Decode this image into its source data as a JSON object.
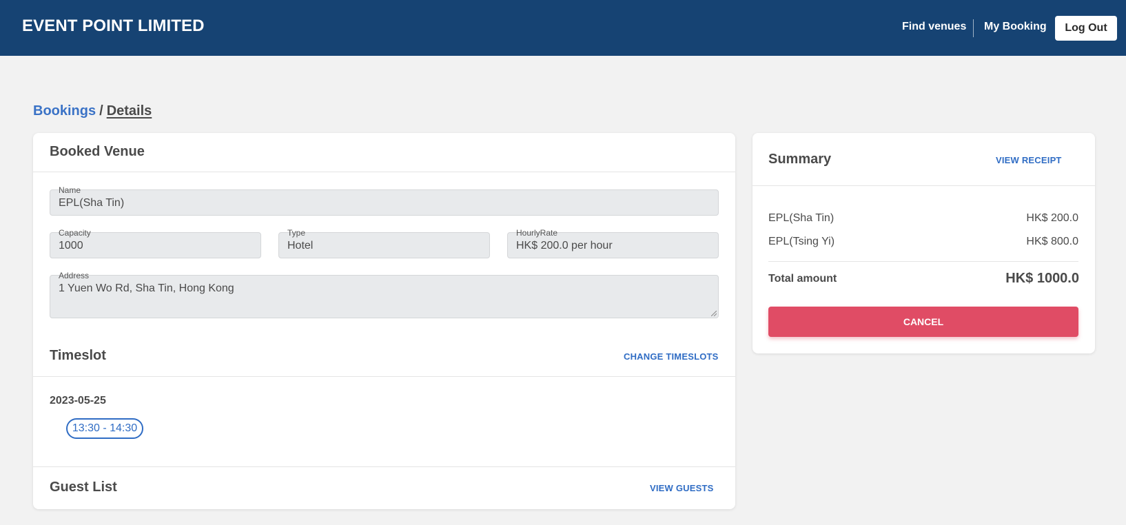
{
  "header": {
    "brand": "EVENT POINT LIMITED",
    "nav": {
      "find_venues": "Find venues",
      "my_booking": "My Booking",
      "logout": "Log Out"
    }
  },
  "breadcrumb": {
    "parent": "Bookings",
    "separator": "/",
    "current": "Details"
  },
  "booked_venue": {
    "title": "Booked Venue",
    "name": {
      "label": "Name",
      "value": "EPL(Sha Tin)"
    },
    "capacity": {
      "label": "Capacity",
      "value": "1000"
    },
    "type": {
      "label": "Type",
      "value": "Hotel"
    },
    "hourly_rate": {
      "label": "HourlyRate",
      "value": "HK$ 200.0 per hour"
    },
    "address": {
      "label": "Address",
      "value": "1 Yuen Wo Rd, Sha Tin, Hong Kong"
    }
  },
  "timeslot": {
    "title": "Timeslot",
    "change_label": "CHANGE TIMESLOTS",
    "date": "2023-05-25",
    "slots": [
      "13:30 - 14:30"
    ]
  },
  "guest_list": {
    "title": "Guest List",
    "view_label": "VIEW GUESTS"
  },
  "summary": {
    "title": "Summary",
    "receipt_label": "VIEW RECEIPT",
    "items": [
      {
        "name": "EPL(Sha Tin)",
        "amount": "HK$ 200.0"
      },
      {
        "name": "EPL(Tsing Yi)",
        "amount": "HK$ 800.0"
      }
    ],
    "total_label": "Total amount",
    "total_amount": "HK$ 1000.0",
    "cancel_label": "CANCEL"
  },
  "colors": {
    "navbar": "#164373",
    "link": "#3a72c6",
    "accent": "#2f6cc4",
    "cancel": "#e04c65",
    "background": "#f2f2f2"
  }
}
